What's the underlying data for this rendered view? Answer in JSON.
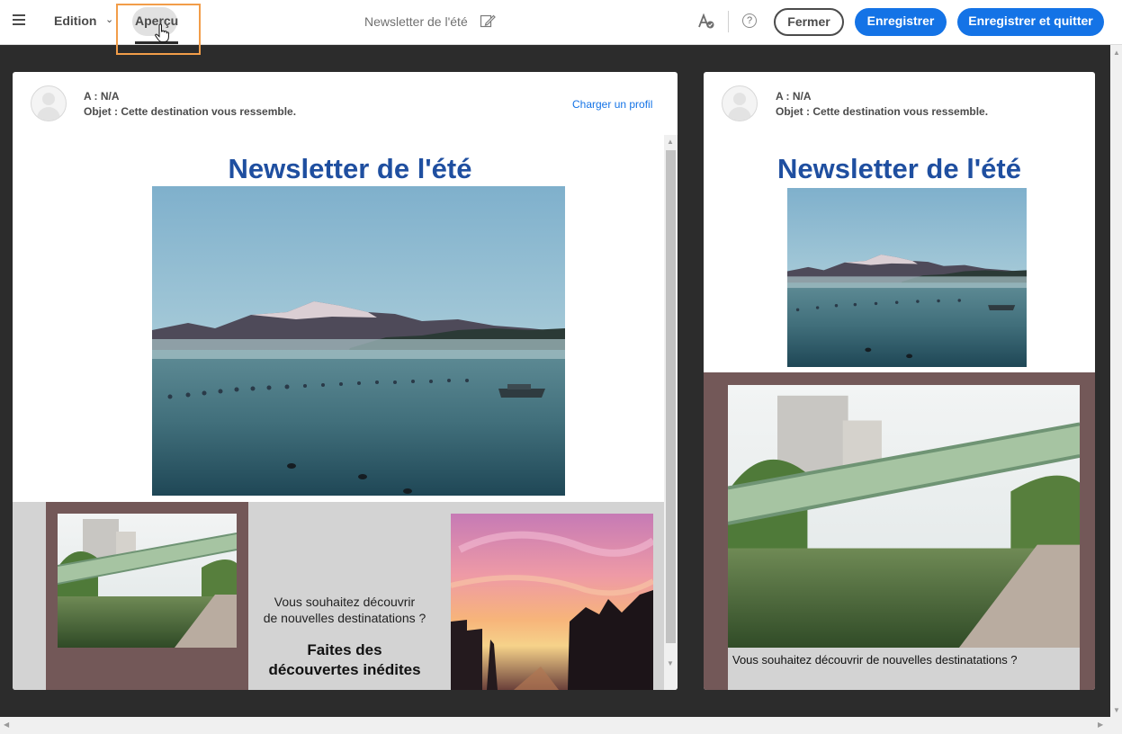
{
  "toolbar": {
    "menu_icon": "hamburger-icon",
    "tab_edition": "Edition",
    "tab_apercu": "Aperçu",
    "document_title": "Newsletter de l'été",
    "edit_icon": "pencil-icon",
    "approval_icon": "approval-icon",
    "help_icon": "help-icon",
    "help_glyph": "?",
    "close_label": "Fermer",
    "save_label": "Enregistrer",
    "save_quit_label": "Enregistrer et quitter"
  },
  "preview_desktop": {
    "to_line": "A : N/A",
    "subject_line": "Objet : Cette destination vous ressemble.",
    "load_profile_link": "Charger un profil",
    "newsletter_title": "Newsletter de l'été",
    "tagline": "Vous souhaitez découvrir de nouvelles destinatations ?",
    "tagline_1": "Vous souhaitez découvrir",
    "tagline_2": "de nouvelles destinatations ?",
    "headline_1": "Faites des",
    "headline_2": "découvertes inédites"
  },
  "preview_mobile": {
    "to_line": "A : N/A",
    "subject_line": "Objet : Cette destination vous ressemble.",
    "newsletter_title": "Newsletter de l'été",
    "caption": "Vous souhaitez découvrir de nouvelles destinatations ?"
  },
  "colors": {
    "accent": "#1473e6",
    "title_blue": "#1f4fa0",
    "highlight": "#f29d49",
    "section_brown": "#735858",
    "section_gray": "#d3d3d3"
  }
}
